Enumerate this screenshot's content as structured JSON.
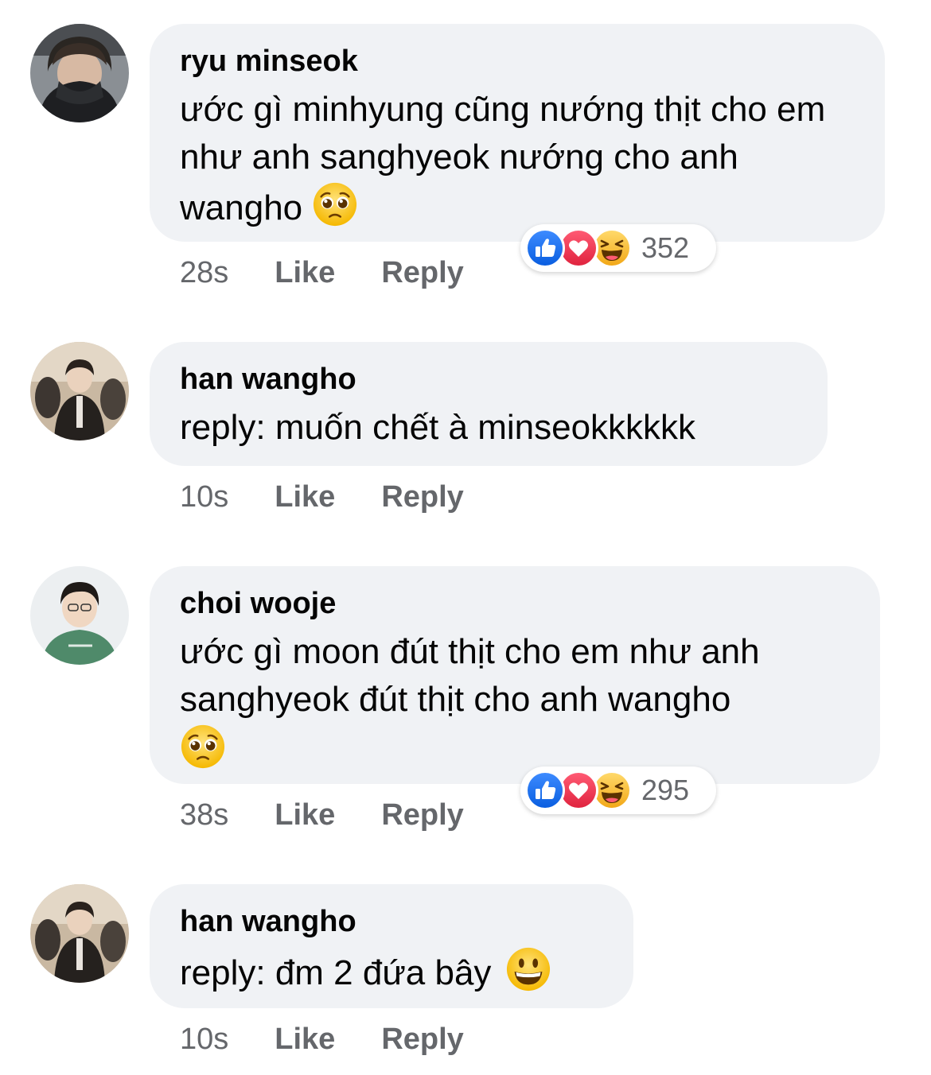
{
  "comments": [
    {
      "author": "ryu minseok",
      "text": "ước gì minhyung cũng nướng thịt cho em như anh sanghyeok nướng cho anh wangho",
      "emoji": "pleading-face-icon",
      "time": "28s",
      "like_label": "Like",
      "reply_label": "Reply",
      "reactions": [
        "like-icon",
        "love-icon",
        "haha-icon"
      ],
      "reaction_count": "352"
    },
    {
      "author": "han wangho",
      "text": "reply: muốn chết à minseokkkkkk",
      "time": "10s",
      "like_label": "Like",
      "reply_label": "Reply"
    },
    {
      "author": "choi wooje",
      "text": "ước gì moon đút thịt cho em như anh sanghyeok đút thịt cho anh wangho",
      "emoji": "pleading-face-icon",
      "time": "38s",
      "like_label": "Like",
      "reply_label": "Reply",
      "reactions": [
        "like-icon",
        "love-icon",
        "haha-icon"
      ],
      "reaction_count": "295"
    },
    {
      "author": "han wangho",
      "text": "reply: đm 2 đứa bây",
      "emoji": "grinning-face-icon",
      "time": "10s",
      "like_label": "Like",
      "reply_label": "Reply"
    }
  ],
  "colors": {
    "bubble": "#f0f2f5",
    "meta_text": "#65676b",
    "like_blue": "#1877f2",
    "love_red": "#f33e58",
    "haha_yellow": "#f7b125"
  }
}
